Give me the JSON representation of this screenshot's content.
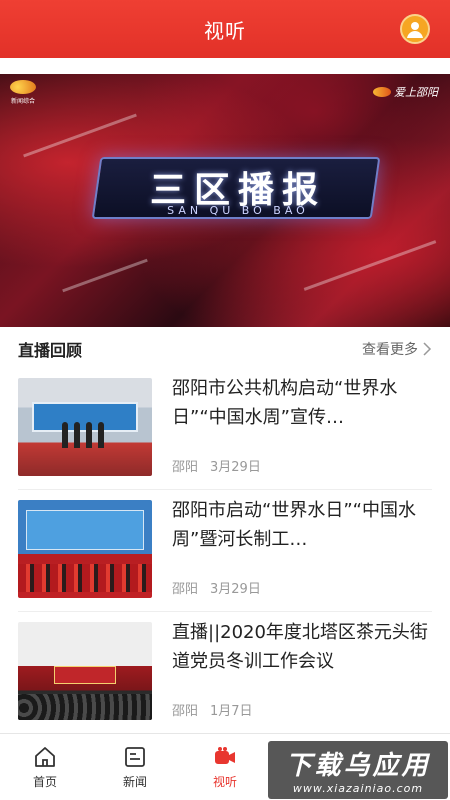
{
  "header": {
    "title": "视听",
    "avatar_icon": "user-avatar-icon"
  },
  "banner": {
    "title": "三区播报",
    "subtitle": "SAN QU BO BAO",
    "logo_left": "新闻综合",
    "logo_right": "爱上邵阳"
  },
  "section": {
    "title": "直播回顾",
    "more_label": "查看更多"
  },
  "news": [
    {
      "title": "邵阳市公共机构启动“世界水日”“中国水周”宣传…",
      "source": "邵阳",
      "date": "3月29日"
    },
    {
      "title": "邵阳市启动“世界水日”“中国水周”暨河长制工…",
      "source": "邵阳",
      "date": "3月29日"
    },
    {
      "title": "直播||2020年度北塔区茶元头街道党员冬训工作会议",
      "source": "邵阳",
      "date": "1月7日"
    }
  ],
  "tabbar": {
    "items": [
      {
        "label": "首页",
        "icon": "home-icon"
      },
      {
        "label": "新闻",
        "icon": "news-icon"
      },
      {
        "label": "视听",
        "icon": "video-icon",
        "active": true
      }
    ]
  },
  "watermark": {
    "main": "下载乌应用",
    "url": "www.xiazainiao.com"
  },
  "colors": {
    "accent": "#e8362f",
    "avatar": "#f6a623"
  }
}
